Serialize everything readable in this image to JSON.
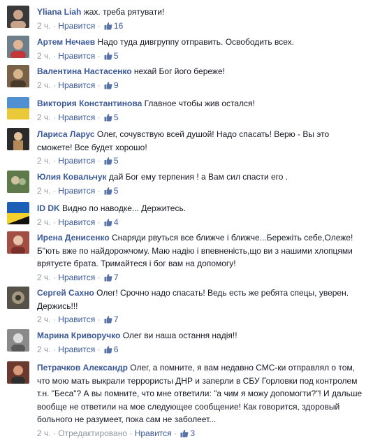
{
  "ui": {
    "like_label": "Нравится",
    "separator": "·"
  },
  "comments": [
    {
      "author": "Yliana Liah",
      "text": "жах. треба рятувати!",
      "time": "2 ч.",
      "edited": "",
      "likes": "16",
      "avatar": {
        "bg": "#3a3a3a",
        "fg": "#c9a48a"
      }
    },
    {
      "author": "Артем Нечаев",
      "text": "Надо туда дивгруппу отправить. Освободить всех.",
      "time": "2 ч.",
      "edited": "",
      "likes": "5",
      "avatar": {
        "bg": "#6e7f8a",
        "fg": "#c2373a"
      }
    },
    {
      "author": "Валентина Настасенко",
      "text": "нехай Бог його береже!",
      "time": "2 ч.",
      "edited": "",
      "likes": "9",
      "avatar": {
        "bg": "#7a6249",
        "fg": "#d8b48a"
      }
    },
    {
      "author": "Виктория Константинова",
      "text": "Главное чтобы жив остался!",
      "time": "2 ч.",
      "edited": "",
      "likes": "5",
      "avatar": {
        "bg": "#4f8fd2",
        "fg": "#e9c83a"
      }
    },
    {
      "author": "Лариса Ларус",
      "text": "Олег, сочувствую всей душой! Надо спасать! Верю - Вы это сможете! Все будет хорошо!",
      "time": "2 ч.",
      "edited": "",
      "likes": "5",
      "avatar": {
        "bg": "#2b2b2b",
        "fg": "#b38a56"
      }
    },
    {
      "author": "Юлия Ковальчук",
      "text": "дай Бог ему терпения ! а Вам сил спасти его .",
      "time": "2 ч.",
      "edited": "",
      "likes": "5",
      "avatar": {
        "bg": "#5f7a4a",
        "fg": "#cfc2a0"
      }
    },
    {
      "author": "ID DK",
      "text": "Видно по наводке... Держитесь.",
      "time": "2 ч.",
      "edited": "",
      "likes": "4",
      "avatar": {
        "bg": "#1b5fb7",
        "fg": "#f3d12c"
      }
    },
    {
      "author": "Ирена Денисенко",
      "text": "Снаряди рвуться все ближче і ближче...Бережіть себе,Олеже! Б\"ють вже по найдорожчому. Маю надію і впевненість,що ви з нашими хлопцями врятуєте брата. Тримайтеся і бог вам на допомогу!",
      "time": "2 ч.",
      "edited": "",
      "likes": "7",
      "avatar": {
        "bg": "#a24e44",
        "fg": "#e6c3a8"
      }
    },
    {
      "author": "Сергей Сахно",
      "text": "Олег! Срочно надо спасать! Ведь есть же ребята спецы, уверен. Держись!!!",
      "time": "2 ч.",
      "edited": "",
      "likes": "7",
      "avatar": {
        "bg": "#56524a",
        "fg": "#a3987f"
      }
    },
    {
      "author": "Марина Криворучко",
      "text": "Олег ви наша остання надія!!",
      "time": "2 ч.",
      "edited": "",
      "likes": "6",
      "avatar": {
        "bg": "#8a8a8a",
        "fg": "#dcdcdc"
      }
    },
    {
      "author": "Петрачков Александр",
      "text": "Олег, а помните, я вам недавно СМС-ки отправлял о том, что мою мать выкрали террористы ДНР и заперли в СБУ Горловки под контролем т.н. \"Беса\"? А вы помните, что мне ответили: \"а чим я можу допомогти?\"! И дальше вообще не ответили на мое следующее сообщение! Как говорится, здоровый больного не разумеет, пока сам не заболеет...",
      "time": "2 ч.",
      "edited": "Отредактировано",
      "likes": "3",
      "avatar": {
        "bg": "#6b3a2e",
        "fg": "#d89a7a"
      }
    }
  ]
}
